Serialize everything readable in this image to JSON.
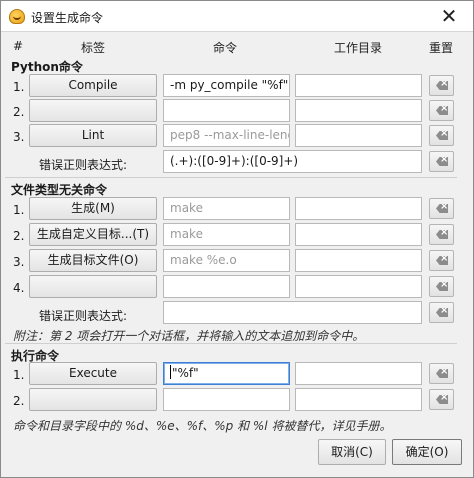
{
  "window": {
    "title": "设置生成命令",
    "close_glyph": "✕"
  },
  "headers": {
    "hash": "#",
    "label": "标签",
    "command": "命令",
    "workdir": "工作目录",
    "reset": "重置"
  },
  "python": {
    "title": "Python命令",
    "rows": [
      {
        "num": "1.",
        "label": "Compile",
        "command": "-m py_compile \"%f\"",
        "command_placeholder": false,
        "workdir": ""
      },
      {
        "num": "2.",
        "label": "",
        "command": "",
        "command_placeholder": false,
        "workdir": ""
      },
      {
        "num": "3.",
        "label": "Lint",
        "command": "pep8 --max-line-leng",
        "command_placeholder": true,
        "workdir": ""
      }
    ],
    "regex_label": "错误正则表达式:",
    "regex_value": "(.+):([0-9]+):([0-9]+)"
  },
  "independent": {
    "title": "文件类型无关命令",
    "rows": [
      {
        "num": "1.",
        "label": "生成(M)",
        "command": "make",
        "command_placeholder": true,
        "workdir": ""
      },
      {
        "num": "2.",
        "label": "生成自定义目标...(T)",
        "command": "make",
        "command_placeholder": true,
        "workdir": ""
      },
      {
        "num": "3.",
        "label": "生成目标文件(O)",
        "command": "make %e.o",
        "command_placeholder": true,
        "workdir": ""
      },
      {
        "num": "4.",
        "label": "",
        "command": "",
        "command_placeholder": false,
        "workdir": ""
      }
    ],
    "regex_label": "错误正则表达式:",
    "regex_value": ""
  },
  "note1": "附注：第 2 项会打开一个对话框，并将输入的文本追加到命令中。",
  "execute": {
    "title": "执行命令",
    "rows": [
      {
        "num": "1.",
        "label": "Execute",
        "command": "\"%f\"",
        "command_placeholder": false,
        "workdir": ""
      },
      {
        "num": "2.",
        "label": "",
        "command": "",
        "command_placeholder": false,
        "workdir": ""
      }
    ]
  },
  "note2": "命令和目录字段中的 %d、%e、%f、%p 和 %l 将被替代，详见手册。",
  "buttons": {
    "cancel": "取消(C)",
    "ok": "确定(O)"
  }
}
